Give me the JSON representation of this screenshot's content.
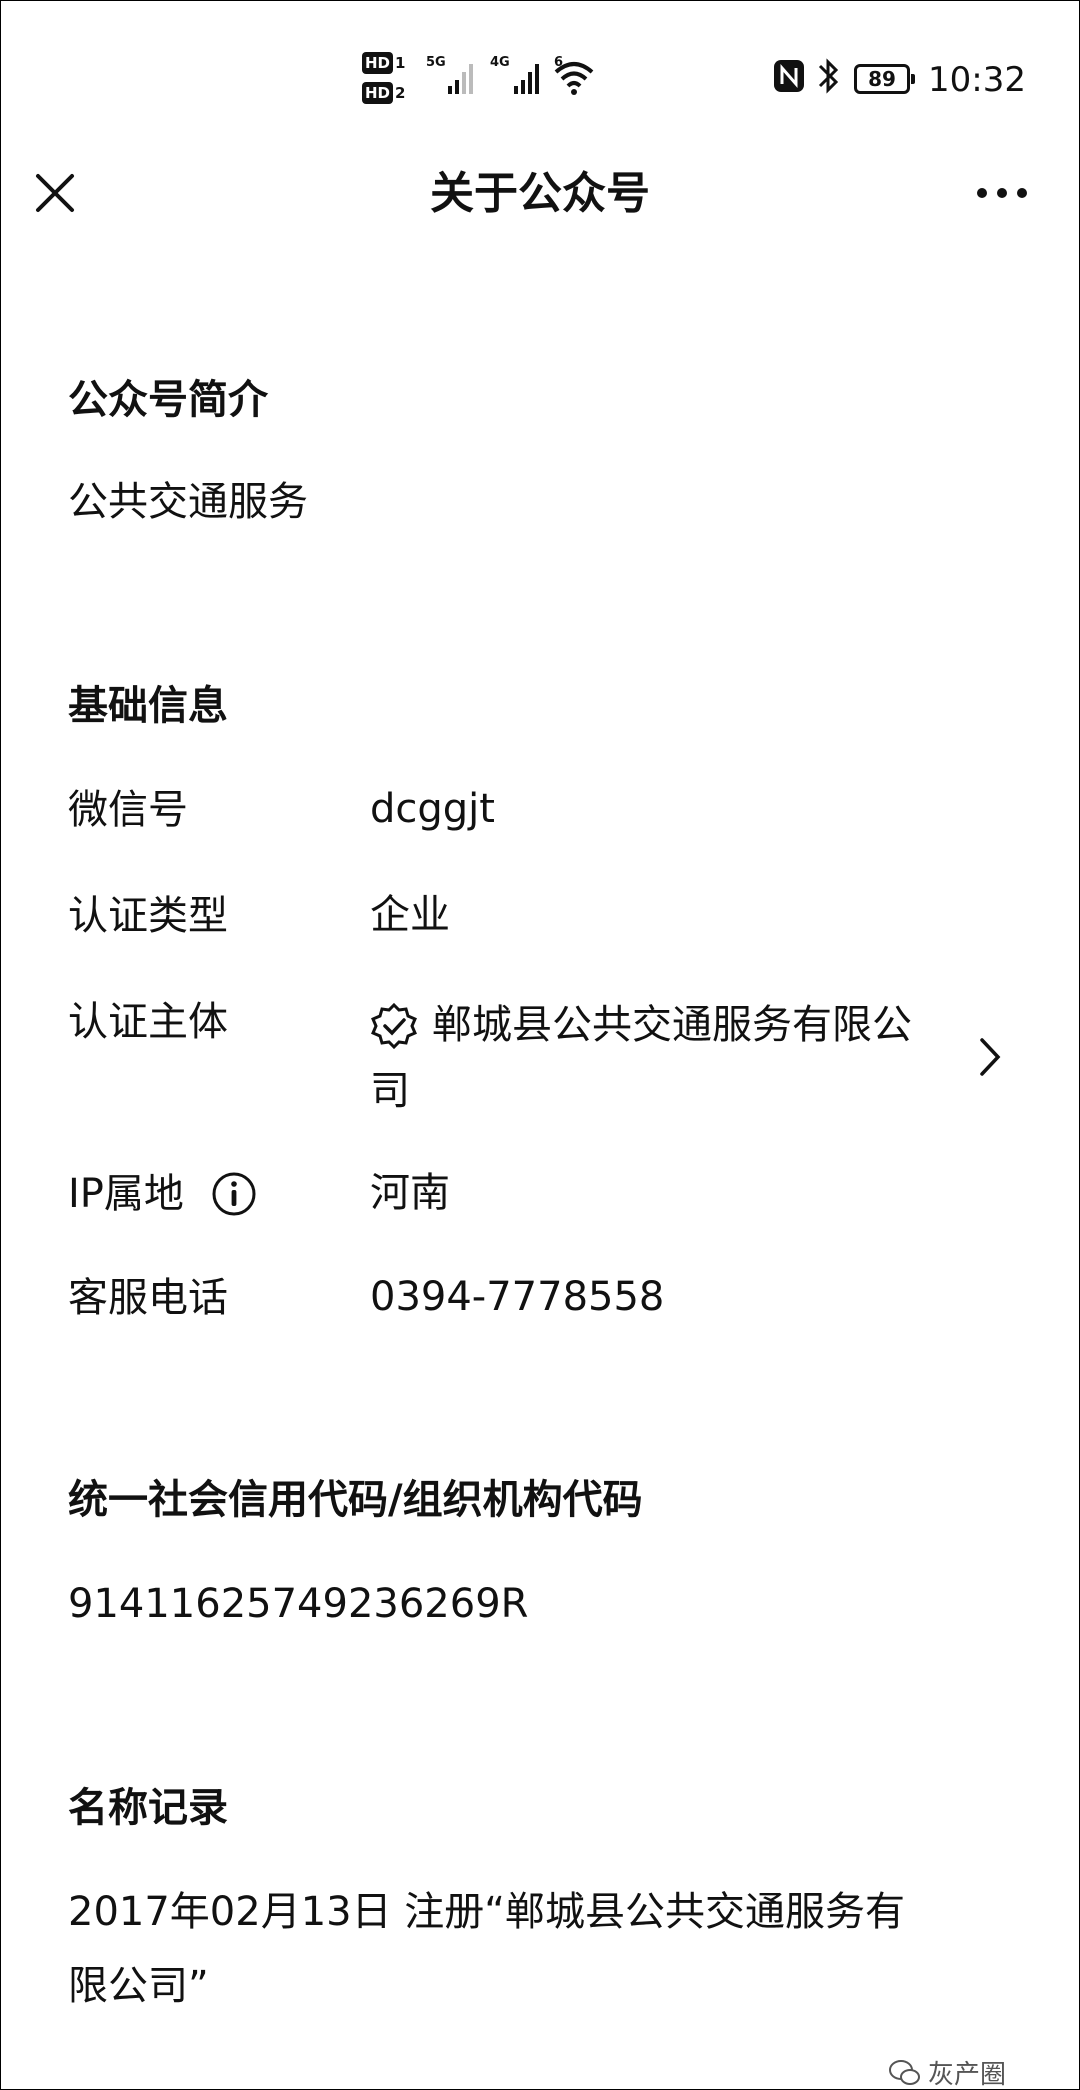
{
  "status_bar": {
    "sim1": "HD 1",
    "sim2": "HD 2",
    "network1": "5G",
    "network2": "4G",
    "wifi_label": "6",
    "battery": "89",
    "time": "10:32",
    "icons": [
      "nfc-icon",
      "bluetooth-icon",
      "battery-icon",
      "wifi-icon",
      "signal-icon"
    ]
  },
  "header": {
    "title": "关于公众号",
    "close_icon": "close-icon",
    "more_icon": "more-icon"
  },
  "intro": {
    "title": "公众号简介",
    "text": "公共交通服务"
  },
  "basic_info": {
    "title": "基础信息",
    "rows": [
      {
        "label": "微信号",
        "value": "dcggjt"
      },
      {
        "label": "认证类型",
        "value": "企业"
      },
      {
        "label": "认证主体",
        "value": "郸城县公共交通服务有限公司"
      },
      {
        "label": "IP属地",
        "value": "河南"
      },
      {
        "label": "客服电话",
        "value": "0394-7778558"
      }
    ]
  },
  "credit_code": {
    "title": "统一社会信用代码/组织机构代码",
    "value": "91411625749236269R"
  },
  "name_records": {
    "title": "名称记录",
    "line1": "2017年02月13日 注册“郸城县公共交通服务有",
    "line2": "限公司”"
  },
  "watermark": {
    "text": "灰产圈"
  }
}
